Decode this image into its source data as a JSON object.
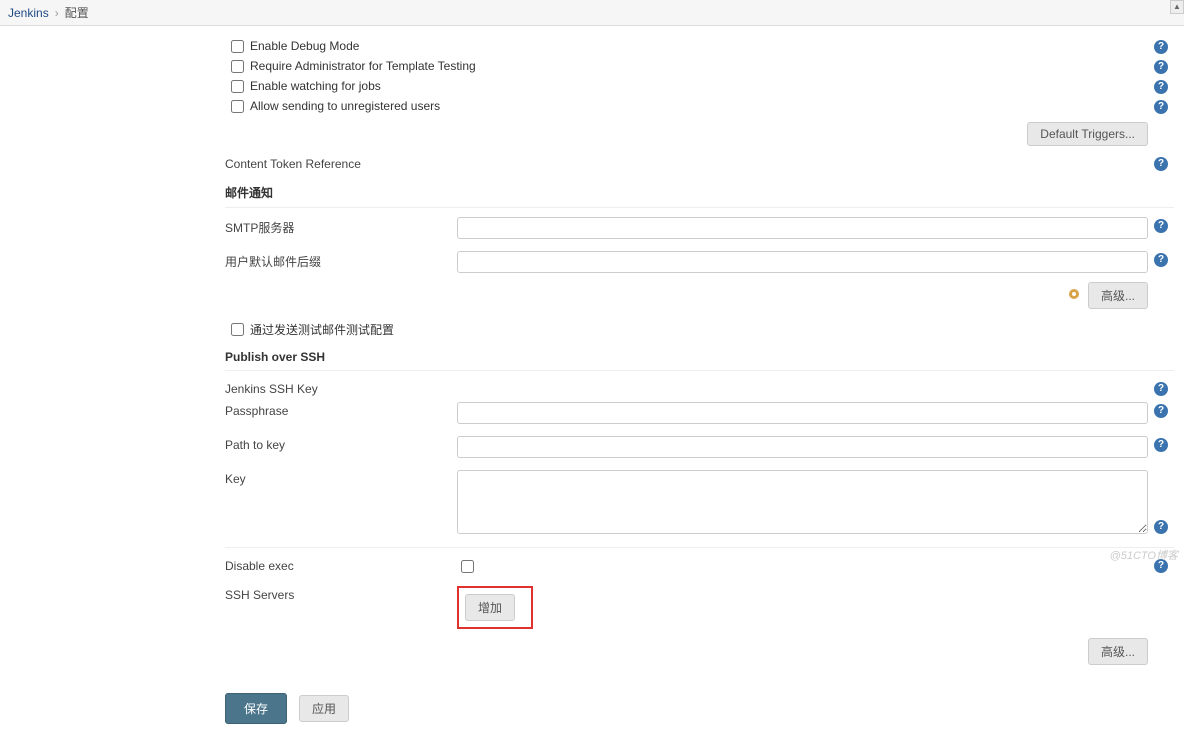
{
  "breadcrumb": {
    "root": "Jenkins",
    "current": "配置"
  },
  "email_ext": {
    "enable_debug": "Enable Debug Mode",
    "require_admin": "Require Administrator for Template Testing",
    "enable_watching": "Enable watching for jobs",
    "allow_unregistered": "Allow sending to unregistered users",
    "default_triggers_btn": "Default Triggers...",
    "content_token_ref": "Content Token Reference"
  },
  "mailer": {
    "section": "邮件通知",
    "smtp_label": "SMTP服务器",
    "smtp_value": "",
    "suffix_label": "用户默认邮件后缀",
    "suffix_value": "",
    "advanced_btn": "高级...",
    "test_config": "通过发送测试邮件测试配置"
  },
  "ssh": {
    "section": "Publish over SSH",
    "jenkins_key": "Jenkins SSH Key",
    "passphrase_label": "Passphrase",
    "passphrase_value": "",
    "path_label": "Path to key",
    "path_value": "",
    "key_label": "Key",
    "key_value": "",
    "disable_exec": "Disable exec",
    "ssh_servers": "SSH Servers",
    "add_btn": "增加",
    "advanced_btn": "高级..."
  },
  "footer": {
    "save": "保存",
    "apply": "应用"
  },
  "watermark": "@51CTO博客"
}
